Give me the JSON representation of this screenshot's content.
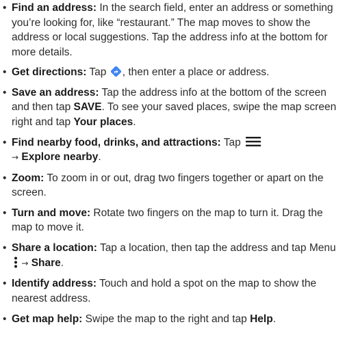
{
  "items": [
    {
      "title": "Find an address:",
      "text": "In the search field, enter an address or something you’re looking for, like “restaurant.” The map moves to show the address or local suggestions. Tap the address info at the bottom for more details."
    },
    {
      "title": "Get directions:",
      "pre": "Tap",
      "icon": "directions-icon",
      "post": ", then enter a place or address."
    },
    {
      "title": "Save an address:",
      "text1": "Tap the address info at the bottom of the screen and then tap",
      "bold1": "SAVE",
      "text2": ". To see your saved places, swipe the map screen right and tap",
      "bold2": "Your places",
      "text3": "."
    },
    {
      "title": "Find nearby food, drinks, and attractions:",
      "pre": "Tap",
      "icon": "menu-icon",
      "arrow": "→",
      "bold": "Explore nearby",
      "post": "."
    },
    {
      "title": "Zoom:",
      "text": "To zoom in or out, drag two fingers together or apart on the screen."
    },
    {
      "title": "Turn and move:",
      "text": "Rotate two fingers on the map to turn it. Drag the map to move it."
    },
    {
      "title": "Share a location:",
      "text1": "Tap a location, then tap the address and tap Menu",
      "icon": "more-vert-icon",
      "arrow": "→",
      "bold": "Share",
      "post": "."
    },
    {
      "title": "Identify address:",
      "text": "Touch and hold a spot on the map to show the nearest address."
    },
    {
      "title": "Get map help:",
      "text": "Swipe the map to the right and tap",
      "bold": "Help",
      "post": "."
    }
  ],
  "colors": {
    "text": "#2b2b2b",
    "directions_icon": "#4285f4"
  }
}
